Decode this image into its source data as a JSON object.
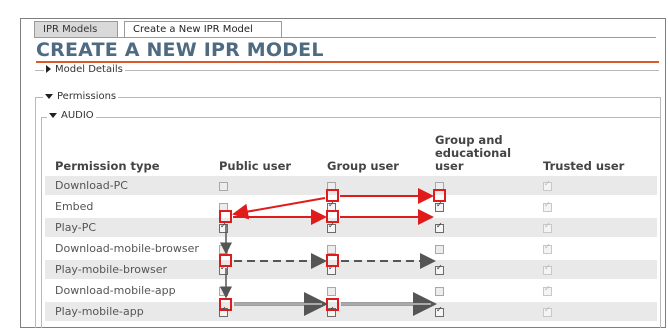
{
  "tabs": [
    {
      "label": "IPR Models",
      "active": false
    },
    {
      "label": "Create a New IPR Model",
      "active": true
    }
  ],
  "page_title": "CREATE A NEW IPR MODEL",
  "sections": {
    "model_details": "Model Details",
    "permissions": "Permissions",
    "audio": "AUDIO"
  },
  "table": {
    "headers": {
      "permission_type": "Permission type",
      "public_user": "Public user",
      "group_user": "Group user",
      "group_educational_line1": "Group and",
      "group_educational_line2": "educational user",
      "trusted_user": "Trusted user"
    },
    "rows": [
      {
        "label": "Download-PC",
        "public": false,
        "group": false,
        "group_edu": false,
        "trusted": true
      },
      {
        "label": "Embed",
        "public": false,
        "group": true,
        "group_edu": true,
        "trusted": true
      },
      {
        "label": "Play-PC",
        "public": true,
        "group": true,
        "group_edu": true,
        "trusted": true
      },
      {
        "label": "Download-mobile-browser",
        "public": false,
        "group": false,
        "group_edu": false,
        "trusted": true
      },
      {
        "label": "Play-mobile-browser",
        "public": true,
        "group": true,
        "group_edu": true,
        "trusted": true
      },
      {
        "label": "Download-mobile-app",
        "public": false,
        "group": false,
        "group_edu": false,
        "trusted": true
      },
      {
        "label": "Play-mobile-app",
        "public": true,
        "group": true,
        "group_edu": true,
        "trusted": true
      }
    ]
  },
  "colors": {
    "title": "#4f6b82",
    "title_rule": "#d95a2b",
    "highlight": "#e01b1b",
    "row_shade": "#e9e9e9"
  }
}
